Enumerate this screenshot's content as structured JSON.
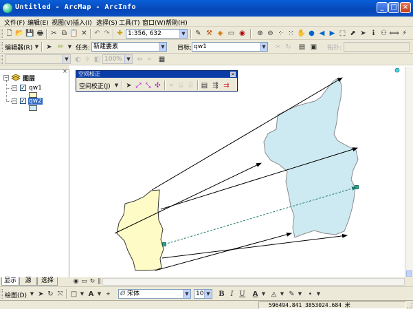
{
  "window": {
    "title": "Untitled - ArcMap - ArcInfo",
    "controls": {
      "minimize": "_",
      "maximize": "□",
      "close": "×"
    }
  },
  "menu": [
    "文件(F)",
    "编辑(E)",
    "视图(V)",
    "插入(I)",
    "选择(S)",
    "工具(T)",
    "窗口(W)",
    "帮助(H)"
  ],
  "standard_toolbar": {
    "scale": "1:356, 632"
  },
  "editor_toolbar": {
    "editor_label": "编辑器(R)",
    "task_label": "任务:",
    "task_value": "新建要素",
    "target_label": "目标:",
    "target_value": "qw1",
    "topology_label": "拓扑:"
  },
  "effects_toolbar": {
    "transparency_value": "100%"
  },
  "toc": {
    "root_label": "图层",
    "layers": [
      {
        "name": "qw1",
        "checked": true,
        "expanded": true,
        "color": "#fffbc6",
        "selected": false
      },
      {
        "name": "qw2",
        "checked": true,
        "expanded": true,
        "color": "#cde9f2",
        "selected": true
      }
    ],
    "tabs": [
      "显示",
      "源",
      "选择"
    ]
  },
  "spatial_adjustment": {
    "title": "空间校正",
    "menu_label": "空间校正(J)"
  },
  "map": {
    "layer1_fill": "#fffbc6",
    "layer2_fill": "#cde9f2",
    "link_color": "#000000",
    "selected_link_color": "#1e7b6e"
  },
  "draw_toolbar": {
    "draw_label": "绘图(D)",
    "font_name": "宋体",
    "font_size": "10"
  },
  "status": {
    "coordinates": "596494.841   3853024.684 米"
  },
  "colors": {
    "title_bar": "#0a5fd8",
    "chrome": "#ece9d8",
    "selection": "#316ac5"
  }
}
